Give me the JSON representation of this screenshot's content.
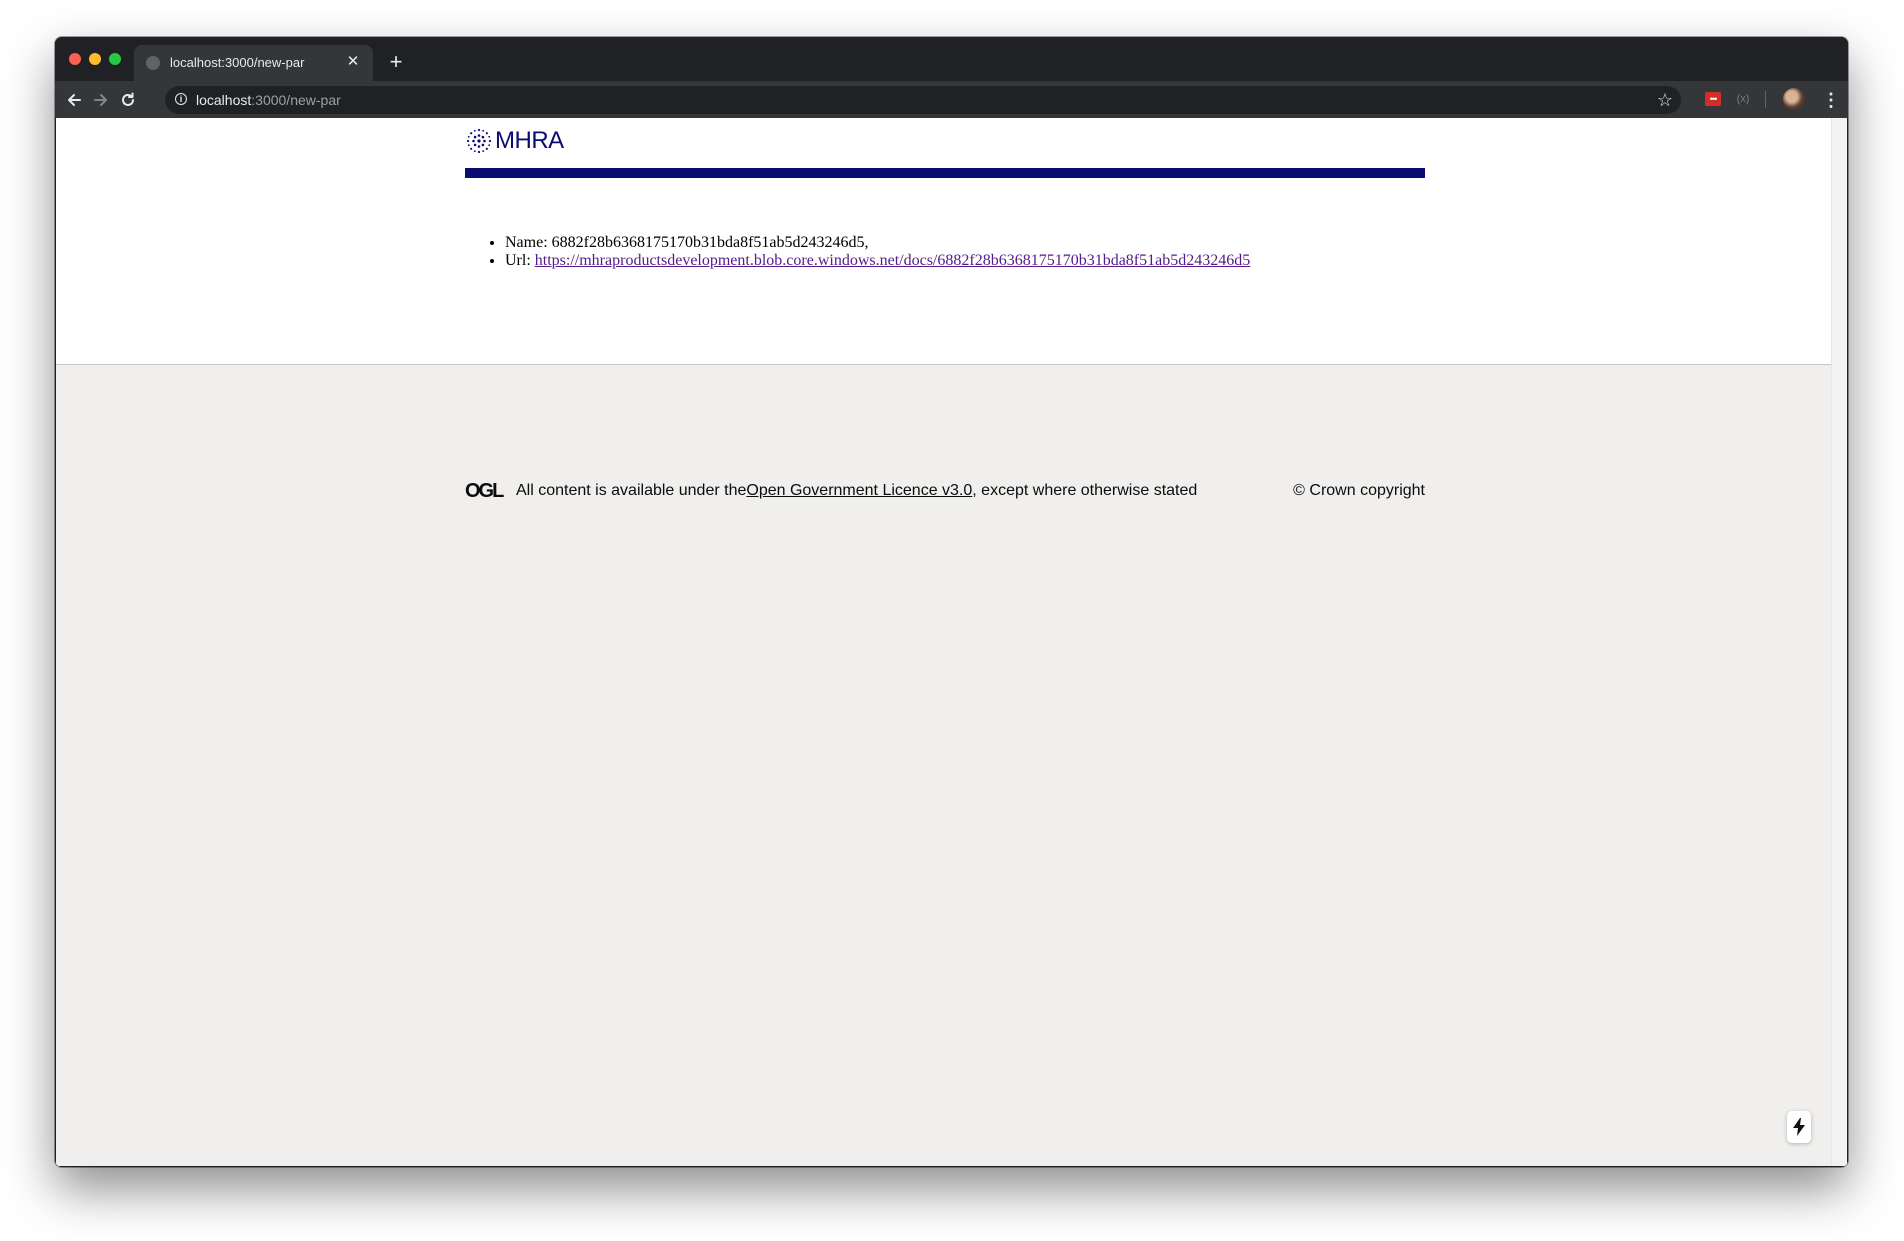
{
  "browser": {
    "tab_title": "localhost:3000/new-par",
    "tab_close": "✕",
    "new_tab": "+",
    "url_host": "localhost",
    "url_path": ":3000/new-par"
  },
  "header": {
    "logo_text": "MHRA",
    "brand_color": "#0b0c71"
  },
  "document": {
    "name_label": "Name:",
    "name_value": "6882f28b6368175170b31bda8f51ab5d243246d5,",
    "url_label": "Url:",
    "url_value": "https://mhraproductsdevelopment.blob.core.windows.net/docs/6882f28b6368175170b31bda8f51ab5d243246d5"
  },
  "footer": {
    "ogl_logo": "OGL",
    "licence_prefix": "All content is available under the",
    "licence_link": "Open Government Licence v3.0",
    "licence_suffix": ", except where otherwise stated",
    "copyright": "© Crown copyright"
  },
  "icons": {
    "back": "back-arrow-icon",
    "forward": "forward-arrow-icon",
    "reload": "reload-icon",
    "info": "info-icon",
    "star": "star-icon",
    "menu": "kebab-menu-icon",
    "next_indicator": "lightning-bolt-icon"
  }
}
